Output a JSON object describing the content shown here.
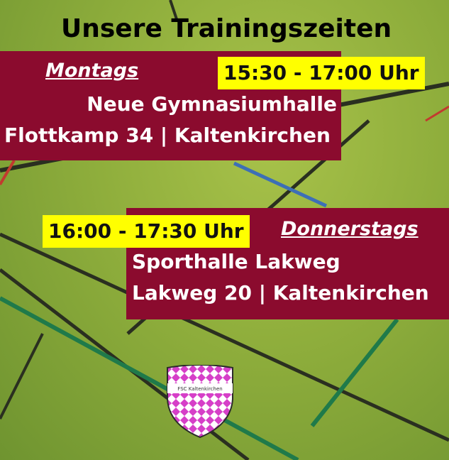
{
  "title": "Unsere Trainingszeiten",
  "session1": {
    "day": "Montags",
    "time": "15:30 - 17:00 Uhr",
    "venue": "Neue Gymnasiumhalle",
    "address": "Flottkamp 34 | Kaltenkirchen"
  },
  "session2": {
    "day": "Donnerstags",
    "time": "16:00 - 17:30 Uhr",
    "venue": "Sporthalle Lakweg",
    "address": "Lakweg 20 | Kaltenkirchen"
  },
  "logo": {
    "text": "FSC Kaltenkirchen"
  },
  "colors": {
    "panel": "#8b0b2e",
    "highlight": "#ffff00",
    "court": "#8fae3c",
    "logo_pink": "#d63fc8"
  }
}
